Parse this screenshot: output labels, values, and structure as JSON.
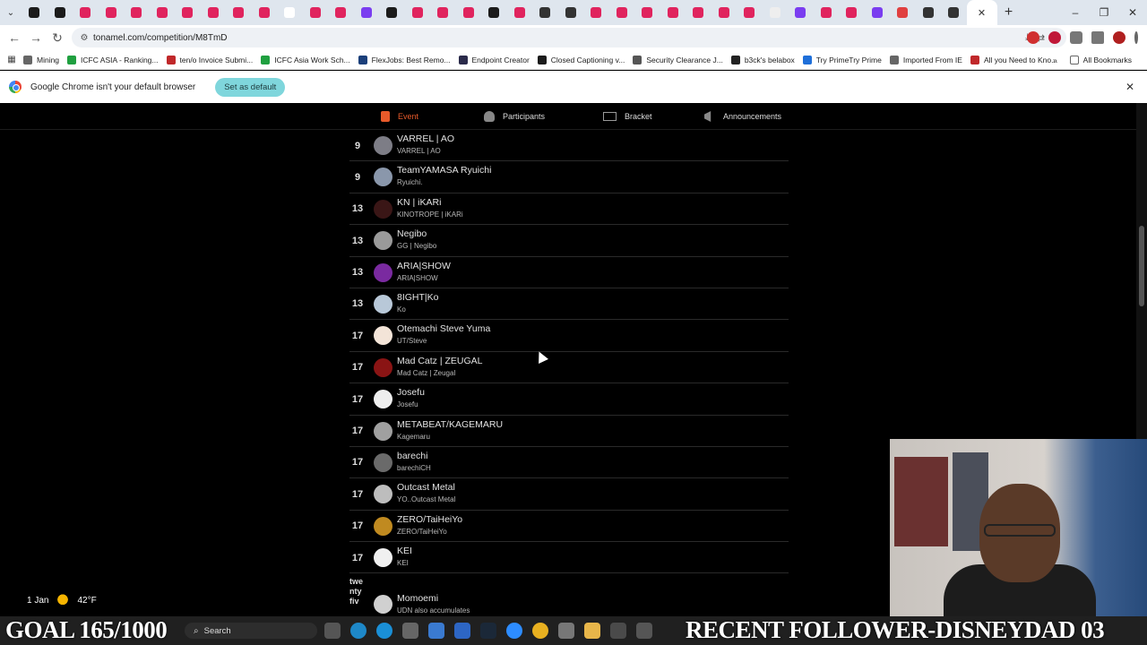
{
  "browser": {
    "url": "tonamel.com/competition/M8TmD",
    "tab_colors": [
      "#1b1b1b",
      "#1b1b1b",
      "#e0245e",
      "#e0245e",
      "#e0245e",
      "#e0245e",
      "#e0245e",
      "#e0245e",
      "#e0245e",
      "#e0245e",
      "#ffffff",
      "#e0245e",
      "#e0245e",
      "#7a3df0",
      "#1b1b1b",
      "#e0245e",
      "#e0245e",
      "#e0245e",
      "#1b1b1b",
      "#e0245e",
      "#333333",
      "#333333",
      "#e0245e",
      "#e0245e",
      "#e0245e",
      "#e0245e",
      "#e0245e",
      "#e0245e",
      "#e0245e",
      "#eeeeee",
      "#7a3df0",
      "#e0245e",
      "#e0245e",
      "#7a3df0",
      "#e04040",
      "#333333",
      "#333333"
    ],
    "new_tab": "+",
    "window_controls": [
      "–",
      "❐",
      "✕"
    ]
  },
  "bookmarks": {
    "items": [
      {
        "label": "Mining",
        "color": "#666666"
      },
      {
        "label": "ICFC ASIA - Ranking...",
        "color": "#20a040"
      },
      {
        "label": "ten/o Invoice Submi...",
        "color": "#c0282a"
      },
      {
        "label": "ICFC Asia Work Sch...",
        "color": "#20a040"
      },
      {
        "label": "FlexJobs: Best Remo...",
        "color": "#1b3f7a"
      },
      {
        "label": "Endpoint Creator",
        "color": "#2a2a4a"
      },
      {
        "label": "Closed Captioning v...",
        "color": "#1b1b1b"
      },
      {
        "label": "Security Clearance J...",
        "color": "#555555"
      },
      {
        "label": "b3ck's belabox",
        "color": "#222222"
      },
      {
        "label": "Try PrimeTry Prime",
        "color": "#1e6fd9"
      },
      {
        "label": "Imported From IE",
        "color": "#666666"
      },
      {
        "label": "All you Need to Kno...",
        "color": "#c0282a"
      }
    ],
    "more": "»",
    "all_bookmarks": "All Bookmarks"
  },
  "infobar": {
    "message": "Google Chrome isn't your default browser",
    "button": "Set as default",
    "close": "✕"
  },
  "event_nav": {
    "items": [
      {
        "label": "Event",
        "active": true
      },
      {
        "label": "Participants",
        "active": false
      },
      {
        "label": "Bracket",
        "active": false
      },
      {
        "label": "Announcements",
        "active": false
      }
    ],
    "accent": "#e85a2a"
  },
  "standings": [
    {
      "rank": "9",
      "name": "VARREL | AO",
      "sub": "VARREL | AO",
      "avatar": "#7d7d86"
    },
    {
      "rank": "9",
      "name": "TeamYAMASA Ryuichi",
      "sub": "Ryuichi.",
      "avatar": "#8a97ab"
    },
    {
      "rank": "13",
      "name": "KN | iKARi",
      "sub": "KINOTROPE | iKARi",
      "avatar": "#3a1616"
    },
    {
      "rank": "13",
      "name": "Negibo",
      "sub": "GG | Negibo",
      "avatar": "#9a9a9a"
    },
    {
      "rank": "13",
      "name": "ARIA|SHOW",
      "sub": "ARIA|SHOW",
      "avatar": "#7a2aa0"
    },
    {
      "rank": "13",
      "name": "8IGHT|Ko",
      "sub": "Ko",
      "avatar": "#b8c8d8"
    },
    {
      "rank": "17",
      "name": "Otemachi Steve Yuma",
      "sub": "UT/Steve",
      "avatar": "#f3e4d8"
    },
    {
      "rank": "17",
      "name": "Mad Catz | ZEUGAL",
      "sub": "Mad Catz | Zeugal",
      "avatar": "#8a1414"
    },
    {
      "rank": "17",
      "name": "Josefu",
      "sub": "Josefu",
      "avatar": "#eeeeee"
    },
    {
      "rank": "17",
      "name": "METABEAT/KAGEMARU",
      "sub": "Kagemaru",
      "avatar": "#a0a0a0"
    },
    {
      "rank": "17",
      "name": "barechi",
      "sub": "barechiCH",
      "avatar": "#6a6a6a"
    },
    {
      "rank": "17",
      "name": "Outcast Metal",
      "sub": "YO..Outcast Metal",
      "avatar": "#bdbdbd"
    },
    {
      "rank": "17",
      "name": "ZERO/TaiHeiYo",
      "sub": "ZERO/TaiHeiYo",
      "avatar": "#c08a20"
    },
    {
      "rank": "17",
      "name": "KEI",
      "sub": "KEI",
      "avatar": "#f0f0f0"
    }
  ],
  "last_row": {
    "rank": "twentyfiv",
    "name": "Momoemi",
    "sub": "UDN also accumulates",
    "avatar": "#d0d0d0"
  },
  "weather": {
    "date": "1 Jan",
    "temp": "42°F"
  },
  "taskbar": {
    "search": "Search",
    "overlay_left": "GOAL 165/1000",
    "overlay_right": "RECENT FOLLOWER-DISNEYDAD 03"
  }
}
